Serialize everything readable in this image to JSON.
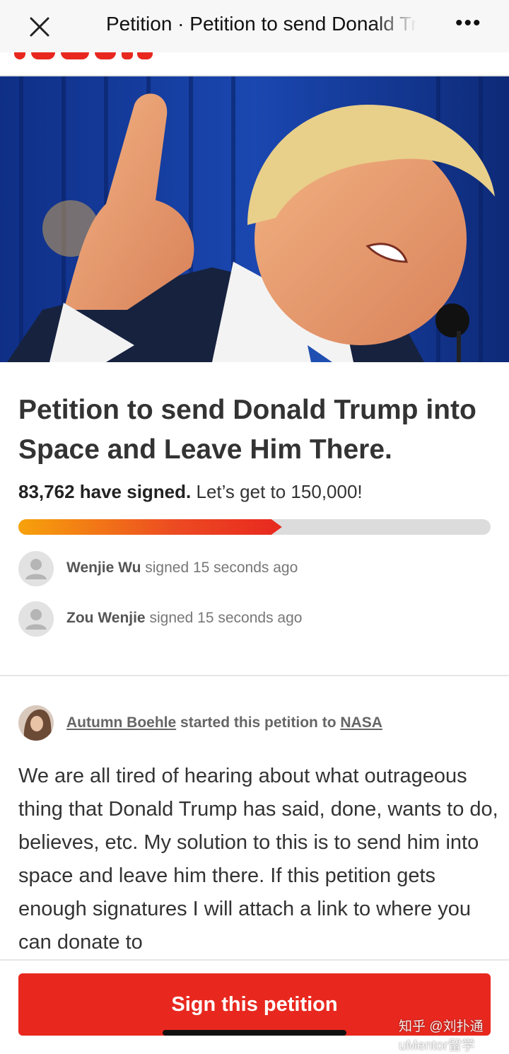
{
  "topbar": {
    "title": "Petition · Petition to send Donald Trump into Space and Leave Him There.",
    "more_label": "•••"
  },
  "site": {
    "logo_text": "change.org"
  },
  "hero": {
    "icon": "photo-of-speaker"
  },
  "petition": {
    "title": "Petition to send Donald Trump into Space and Leave Him There.",
    "signed_count": "83,762 have signed.",
    "goal_text": "Let’s get to 150,000!",
    "progress_fraction": 0.558
  },
  "signers": [
    {
      "name": "Wenjie Wu",
      "action": "signed 15 seconds ago"
    },
    {
      "name": "Zou Wenjie",
      "action": "signed 15 seconds ago"
    }
  ],
  "starter": {
    "name": "Autumn Boehle",
    "action": "started this petition to",
    "target": "NASA"
  },
  "body": "We are all tired of hearing about what outrageous thing that Donald Trump has said, done, wants to do, believes, etc. My solution to this is to send him into space and leave him there. If this petition gets enough signatures I will attach a link to where you can donate to",
  "cta": {
    "label": "Sign this petition"
  },
  "watermark": "知乎 @刘扑通",
  "watermark2": "uMentor留学",
  "colors": {
    "accent": "#e8281f",
    "progress_start": "#f7a20b",
    "track": "#dcdcdc"
  }
}
